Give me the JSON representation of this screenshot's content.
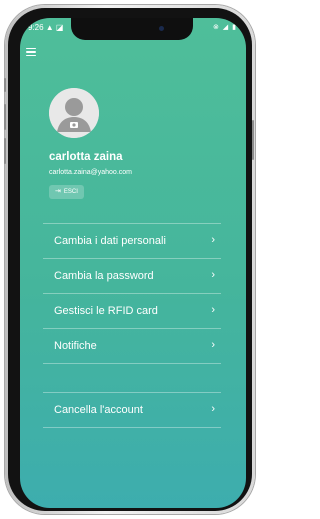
{
  "status_bar": {
    "time": "9:26 ▲ ◪",
    "icons": "⊗ ◢ ▮"
  },
  "profile": {
    "name": "carlotta zaina",
    "email": "carlotta.zaina@yahoo.com",
    "logout_label": "ESCI",
    "logout_icon": "⇥"
  },
  "menu": {
    "items": [
      {
        "label": "Cambia i dati personali",
        "chevron": "›"
      },
      {
        "label": "Cambia la password",
        "chevron": "›"
      },
      {
        "label": "Gestisci le RFID card",
        "chevron": "›"
      },
      {
        "label": "Notifiche",
        "chevron": "›"
      }
    ]
  },
  "account": {
    "delete_label": "Cancella l'account",
    "chevron": "›"
  },
  "colors": {
    "gradient_top": "#4fbe9a",
    "gradient_bottom": "#3dadae"
  }
}
